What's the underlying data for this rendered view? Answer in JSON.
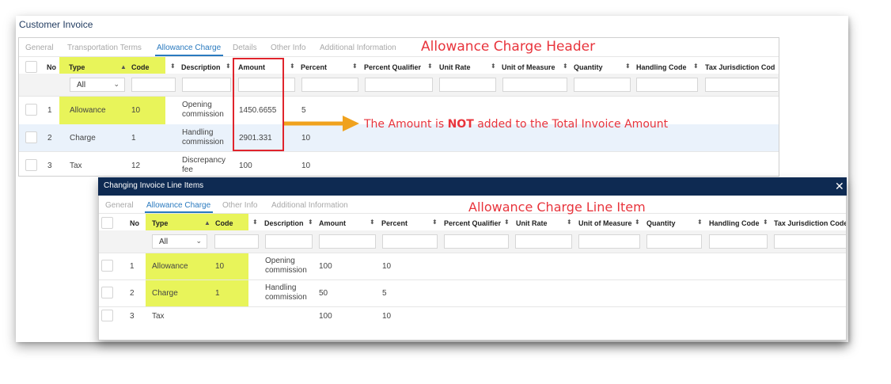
{
  "colors": {
    "accent": "#2a7abf",
    "highlight": "#e8f45a",
    "annotation": "#e8343c",
    "arrow": "#f0a21e",
    "modal_header": "#0e2a52",
    "row_selected": "#eaf2fb"
  },
  "page_title": "Customer Invoice",
  "header_panel": {
    "tabs": [
      "General",
      "Transportation Terms",
      "Allowance Charge",
      "Details",
      "Other Info",
      "Additional Information"
    ],
    "active_tab": "Allowance Charge",
    "columns": [
      "No",
      "Type",
      "Code",
      "Description",
      "Amount",
      "Percent",
      "Percent Qualifier",
      "Unit Rate",
      "Unit of Measure",
      "Quantity",
      "Handling Code",
      "Tax Jurisdiction Cod"
    ],
    "type_filter": {
      "value": "All",
      "icon": "chevron-down-icon"
    },
    "rows": [
      {
        "no": "1",
        "type": "Allowance",
        "code": "10",
        "description": "Opening commission",
        "amount": "1450.6655",
        "percent": "5"
      },
      {
        "no": "2",
        "type": "Charge",
        "code": "1",
        "description": "Handling commission",
        "amount": "2901.331",
        "percent": "10"
      },
      {
        "no": "3",
        "type": "Tax",
        "code": "12",
        "description": "Discrepancy fee",
        "amount": "100",
        "percent": "10"
      }
    ]
  },
  "line_items_modal": {
    "title": "Changing Invoice Line Items",
    "close_icon": "close-icon",
    "tabs": [
      "General",
      "Allowance Charge",
      "Other Info",
      "Additional Information"
    ],
    "active_tab": "Allowance Charge",
    "columns": [
      "No",
      "Type",
      "Code",
      "Description",
      "Amount",
      "Percent",
      "Percent Qualifier",
      "Unit Rate",
      "Unit of Measure",
      "Quantity",
      "Handling Code",
      "Tax Jurisdiction Code"
    ],
    "type_filter": {
      "value": "All",
      "icon": "chevron-down-icon"
    },
    "rows": [
      {
        "no": "1",
        "type": "Allowance",
        "code": "10",
        "description": "Opening commission",
        "amount": "100",
        "percent": "10"
      },
      {
        "no": "2",
        "type": "Charge",
        "code": "1",
        "description": "Handling commission",
        "amount": "50",
        "percent": "5"
      },
      {
        "no": "3",
        "type": "Tax",
        "code": "",
        "description": "",
        "amount": "100",
        "percent": "10"
      }
    ]
  },
  "annotations": {
    "header_label": "Allowance Charge Header",
    "line_item_label": "Allowance Charge Line Item",
    "amount_note_prefix": "The Amount is ",
    "amount_note_bold": "NOT",
    "amount_note_suffix": " added to the Total Invoice Amount"
  }
}
